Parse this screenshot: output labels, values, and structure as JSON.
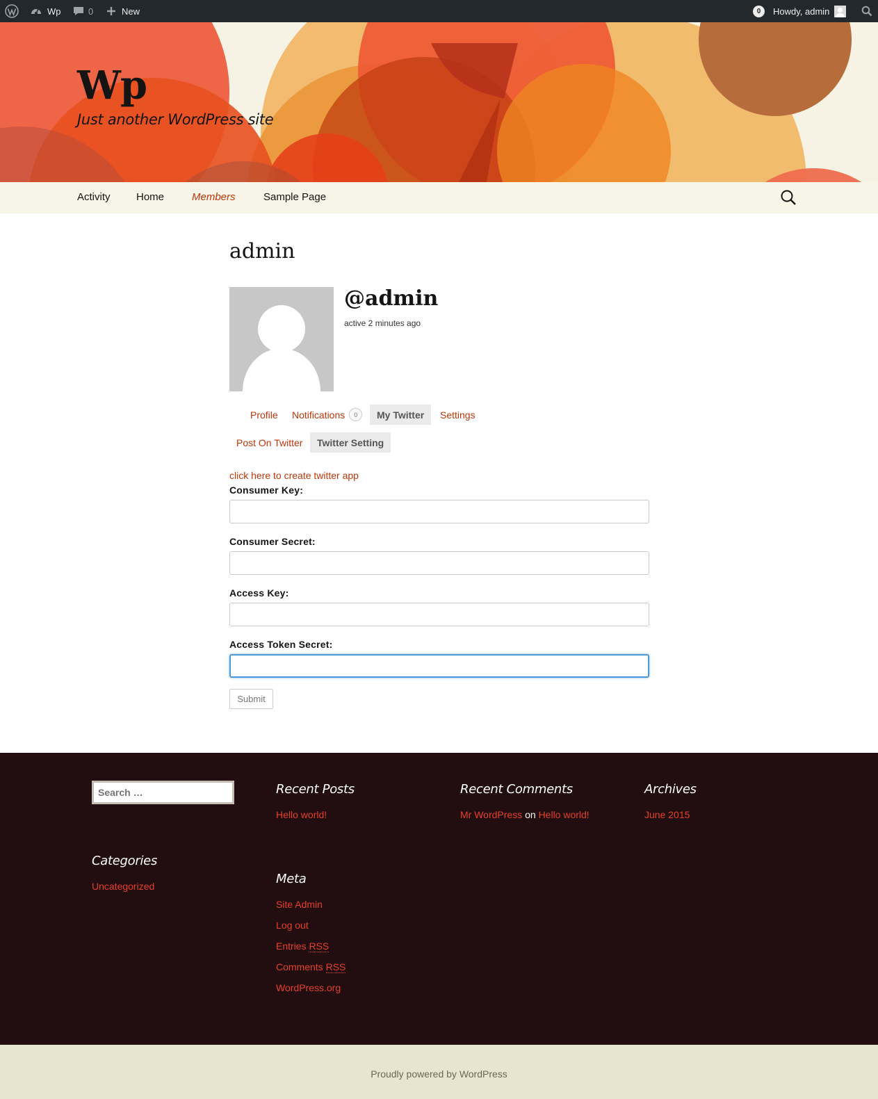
{
  "admin_bar": {
    "site_name": "Wp",
    "comments_count": "0",
    "new_label": "New",
    "notifications_count": "0",
    "greeting": "Howdy, admin"
  },
  "header": {
    "site_title": "Wp",
    "site_description": "Just another WordPress site"
  },
  "nav": {
    "items": [
      "Activity",
      "Home",
      "Members",
      "Sample Page"
    ],
    "active": "Members"
  },
  "profile": {
    "page_title": "admin",
    "mention": "@admin",
    "activity": "active 2 minutes ago",
    "tabs": [
      {
        "label": "Profile"
      },
      {
        "label": "Notifications",
        "count": "0"
      },
      {
        "label": "My Twitter",
        "current": true
      },
      {
        "label": "Settings"
      }
    ],
    "subtabs": [
      {
        "label": "Post On Twitter"
      },
      {
        "label": "Twitter Setting",
        "current": true
      }
    ]
  },
  "form": {
    "create_app_link": "click here to create twitter app",
    "fields": [
      {
        "label": "Consumer Key:",
        "value": ""
      },
      {
        "label": "Consumer Secret:",
        "value": ""
      },
      {
        "label": "Access Key:",
        "value": ""
      },
      {
        "label": "Access Token Secret:",
        "value": ""
      }
    ],
    "submit_label": "Submit"
  },
  "footer": {
    "search_placeholder": "Search …",
    "recent_posts": {
      "title": "Recent Posts",
      "items": [
        "Hello world!"
      ]
    },
    "recent_comments": {
      "title": "Recent Comments",
      "author": "Mr WordPress",
      "on": "on",
      "post": "Hello world!"
    },
    "archives": {
      "title": "Archives",
      "items": [
        "June 2015"
      ]
    },
    "categories": {
      "title": "Categories",
      "items": [
        "Uncategorized"
      ]
    },
    "meta": {
      "title": "Meta",
      "site_admin": "Site Admin",
      "log_out": "Log out",
      "entries": "Entries",
      "comments": "Comments",
      "rss": "RSS",
      "wordpress_org": "WordPress.org"
    }
  },
  "site_info": "Proudly powered by WordPress",
  "colors": {
    "link": "#bc360a",
    "footer_link": "#e63f2a",
    "footer_bg": "#220e10",
    "admin_bar_bg": "#23282d"
  }
}
